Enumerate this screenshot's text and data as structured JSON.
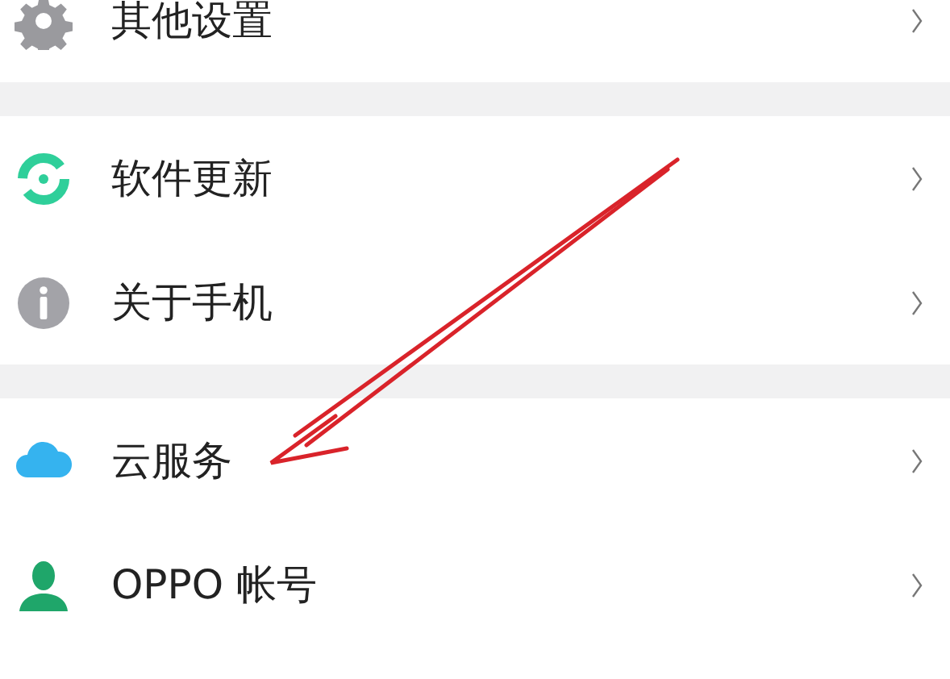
{
  "groups": [
    {
      "items": [
        {
          "label": "其他设置",
          "kind": "gear"
        }
      ]
    },
    {
      "items": [
        {
          "label": "软件更新",
          "kind": "update"
        },
        {
          "label": "关于手机",
          "kind": "info"
        }
      ]
    },
    {
      "items": [
        {
          "label": "云服务",
          "kind": "cloud"
        },
        {
          "label": "OPPO 帐号",
          "kind": "person"
        }
      ]
    }
  ]
}
